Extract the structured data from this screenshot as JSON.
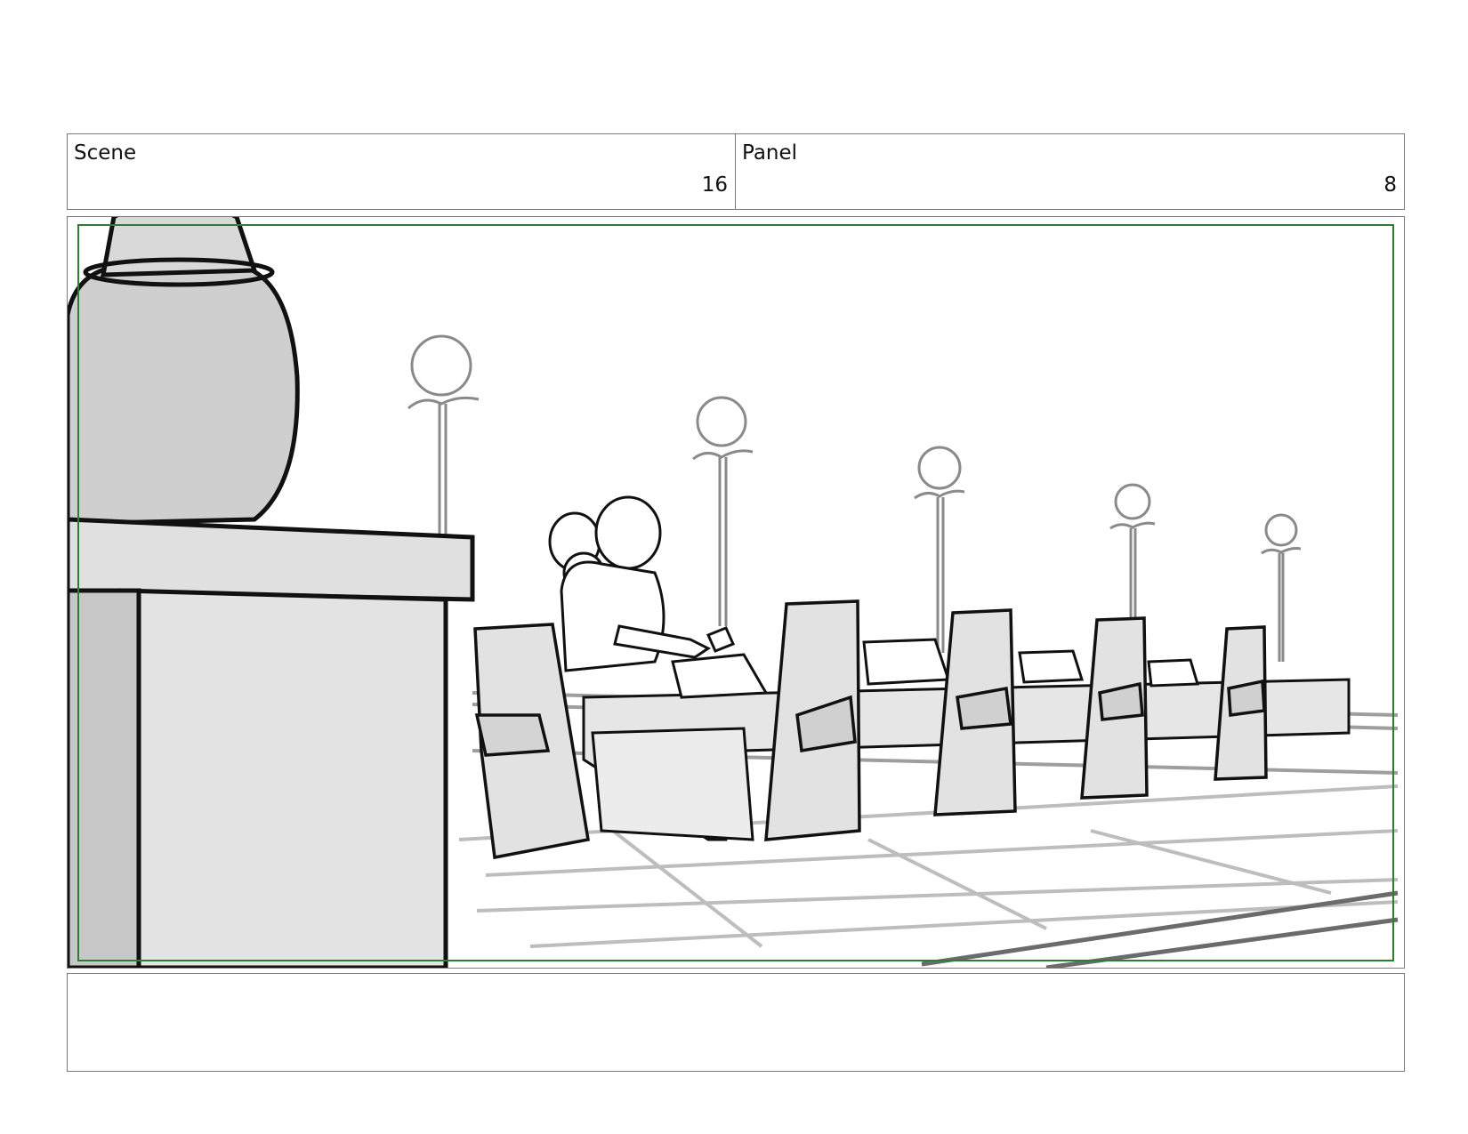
{
  "header": {
    "scene": {
      "label": "Scene",
      "value": "16"
    },
    "panel": {
      "label": "Panel",
      "value": "8"
    }
  },
  "frame": {
    "safe_area_color": "#2e7d32",
    "drawing_description_icon": "storyboard-sketch"
  },
  "notes": {
    "text": ""
  }
}
